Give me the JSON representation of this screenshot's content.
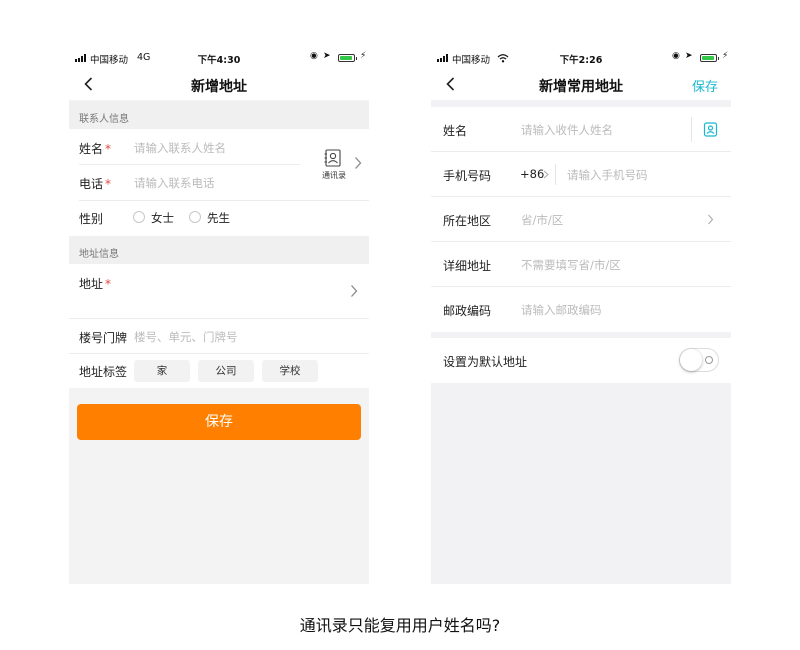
{
  "left_phone": {
    "status": {
      "carrier": "中国移动",
      "network": "4G",
      "time": "下午4:30"
    },
    "nav": {
      "title": "新增地址"
    },
    "contact_section": {
      "title": "联系人信息"
    },
    "name": {
      "label": "姓名",
      "required_mark": "*",
      "placeholder": "请输入联系人姓名"
    },
    "phone": {
      "label": "电话",
      "required_mark": "*",
      "placeholder": "请输入联系电话"
    },
    "contacts_button": {
      "label": "通讯录"
    },
    "gender": {
      "label": "性别",
      "options": [
        "女士",
        "先生"
      ]
    },
    "address_section": {
      "title": "地址信息"
    },
    "address": {
      "label": "地址",
      "required_mark": "*"
    },
    "door": {
      "label": "楼号门牌",
      "placeholder": "楼号、单元、门牌号"
    },
    "tags": {
      "label": "地址标签",
      "options": [
        "家",
        "公司",
        "学校"
      ]
    },
    "save_button": {
      "label": "保存",
      "color": "#ff8000"
    }
  },
  "right_phone": {
    "status": {
      "carrier": "中国移动",
      "time": "下午2:26"
    },
    "nav": {
      "title": "新增常用地址",
      "save_label": "保存",
      "accent": "#1ab8cf"
    },
    "name": {
      "label": "姓名",
      "placeholder": "请输入收件人姓名"
    },
    "mobile": {
      "label": "手机号码",
      "country_code": "+86",
      "placeholder": "请输入手机号码"
    },
    "region": {
      "label": "所在地区",
      "placeholder": "省/市/区"
    },
    "detail": {
      "label": "详细地址",
      "placeholder": "不需要填写省/市/区"
    },
    "postal": {
      "label": "邮政编码",
      "placeholder": "请输入邮政编码"
    },
    "default": {
      "label": "设置为默认地址",
      "enabled": false
    }
  },
  "caption": "通讯录只能复用用户姓名吗?"
}
